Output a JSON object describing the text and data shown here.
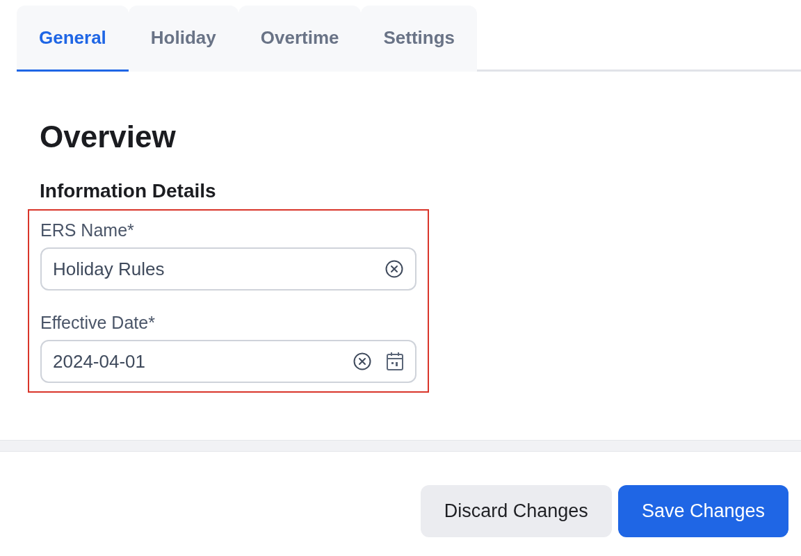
{
  "tabs": [
    {
      "label": "General",
      "selected": true
    },
    {
      "label": "Holiday",
      "selected": false
    },
    {
      "label": "Overtime",
      "selected": false
    },
    {
      "label": "Settings",
      "selected": false
    }
  ],
  "heading": "Overview",
  "section": {
    "title": "Information Details",
    "highlighted": true,
    "fields": [
      {
        "kind": "text",
        "label": "ERS Name*",
        "value": "Holiday Rules"
      },
      {
        "kind": "date",
        "label": "Effective Date*",
        "value": "2024-04-01"
      }
    ]
  },
  "buttons": [
    {
      "kind": "secondary",
      "label": "Discard Changes"
    },
    {
      "kind": "primary",
      "label": "Save Changes"
    }
  ]
}
